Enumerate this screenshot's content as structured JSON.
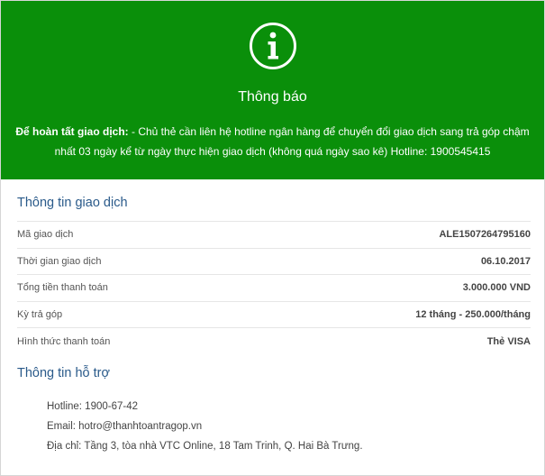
{
  "banner": {
    "title": "Thông báo",
    "message_bold": "Để hoàn tất giao dịch:",
    "message_text": " - Chủ thẻ cần liên hệ hotline ngân hàng để chuyển đổi giao dịch sang trả góp chậm nhất 03 ngày kể từ ngày thực hiện giao dịch (không quá ngày sao kê) Hotline: 1900545415",
    "icon": "info-circle-icon",
    "bg_color": "#0a8f0a"
  },
  "transaction": {
    "title": "Thông tin giao dịch",
    "rows": [
      {
        "label": "Mã giao dịch",
        "value": "ALE1507264795160"
      },
      {
        "label": "Thời gian giao dịch",
        "value": "06.10.2017"
      },
      {
        "label": "Tổng tiền thanh toán",
        "value": "3.000.000 VND"
      },
      {
        "label": "Kỳ trả góp",
        "value": "12 tháng - 250.000/tháng"
      },
      {
        "label": "Hình thức thanh toán",
        "value": "Thẻ VISA"
      }
    ]
  },
  "support": {
    "title": "Thông tin hỗ trợ",
    "lines": [
      "Hotline: 1900-67-42",
      "Email: hotro@thanhtoantragop.vn",
      "Địa chỉ: Tầng 3, tòa nhà VTC Online, 18 Tam Trinh, Q. Hai Bà Trưng."
    ]
  }
}
